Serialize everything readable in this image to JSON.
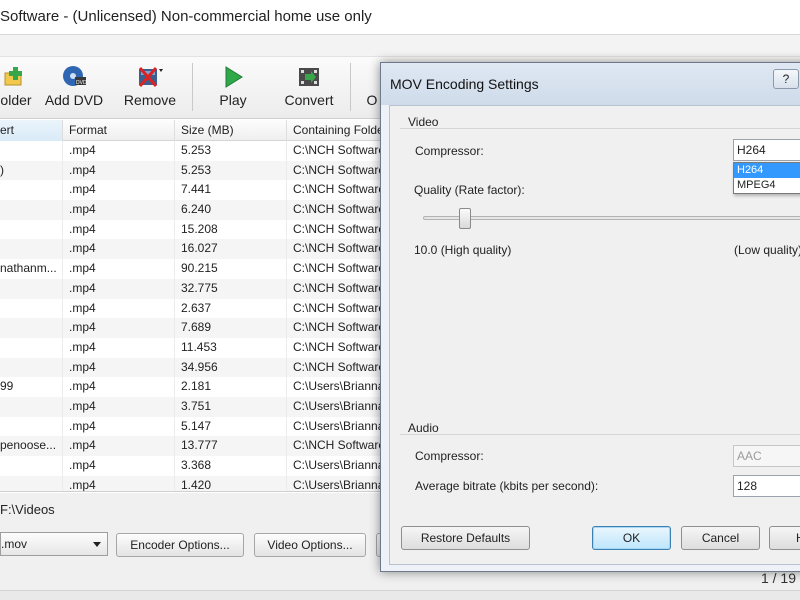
{
  "window": {
    "title": "Software - (Unlicensed) Non-commercial home use only"
  },
  "toolbar": {
    "buttons": [
      {
        "label": "older",
        "icon": "add-folder-icon"
      },
      {
        "label": "Add DVD",
        "icon": "dvd-icon"
      },
      {
        "label": "Remove",
        "icon": "remove-icon"
      },
      {
        "label": "Play",
        "icon": "play-icon"
      },
      {
        "label": "Convert",
        "icon": "convert-icon"
      },
      {
        "label": "O",
        "icon": ""
      }
    ]
  },
  "table": {
    "columns": [
      "ert",
      "Format",
      "Size (MB)",
      "Containing Folde"
    ],
    "rows": [
      [
        "",
        ".mp4",
        "5.253",
        "C:\\NCH Software"
      ],
      [
        ")",
        ".mp4",
        "5.253",
        "C:\\NCH Software"
      ],
      [
        "",
        ".mp4",
        "7.441",
        "C:\\NCH Software"
      ],
      [
        "",
        ".mp4",
        "6.240",
        "C:\\NCH Software"
      ],
      [
        "",
        ".mp4",
        "15.208",
        "C:\\NCH Software"
      ],
      [
        "",
        ".mp4",
        "16.027",
        "C:\\NCH Software"
      ],
      [
        "nathanm...",
        ".mp4",
        "90.215",
        "C:\\NCH Software"
      ],
      [
        "",
        ".mp4",
        "32.775",
        "C:\\NCH Software"
      ],
      [
        "",
        ".mp4",
        "2.637",
        "C:\\NCH Software"
      ],
      [
        "",
        ".mp4",
        "7.689",
        "C:\\NCH Software"
      ],
      [
        "",
        ".mp4",
        "11.453",
        "C:\\NCH Software"
      ],
      [
        "",
        ".mp4",
        "34.956",
        "C:\\NCH Software"
      ],
      [
        "99",
        ".mp4",
        "2.181",
        "C:\\Users\\Brianna"
      ],
      [
        "",
        ".mp4",
        "3.751",
        "C:\\Users\\Brianna"
      ],
      [
        "",
        ".mp4",
        "5.147",
        "C:\\Users\\Brianna"
      ],
      [
        "penoose...",
        ".mp4",
        "13.777",
        "C:\\NCH Software"
      ],
      [
        "",
        ".mp4",
        "3.368",
        "C:\\Users\\Brianna"
      ],
      [
        "",
        ".mp4",
        "1.420",
        "C:\\Users\\Brianna"
      ]
    ]
  },
  "output": {
    "folder": "F:\\Videos",
    "format": ".mov",
    "encoder_options_label": "Encoder Options...",
    "video_options_label": "Video Options..."
  },
  "status": {
    "page": "1 / 19"
  },
  "dialog": {
    "title": "MOV Encoding Settings",
    "help_label": "?",
    "video_group": "Video",
    "compressor_label": "Compressor:",
    "compressor_value": "H264",
    "compressor_options": [
      "H264",
      "MPEG4"
    ],
    "quality_label": "Quality (Rate factor):",
    "quality_value_label": "10.0 (High quality)",
    "quality_high_end_label": "(Low quality)",
    "quality_fraction": 0.11,
    "audio_group": "Audio",
    "audio_compressor_label": "Compressor:",
    "audio_compressor_value": "AAC",
    "bitrate_label": "Average bitrate (kbits per second):",
    "bitrate_value": "128",
    "restore_label": "Restore Defaults",
    "ok_label": "OK",
    "cancel_label": "Cancel",
    "help_button_label": "H"
  }
}
